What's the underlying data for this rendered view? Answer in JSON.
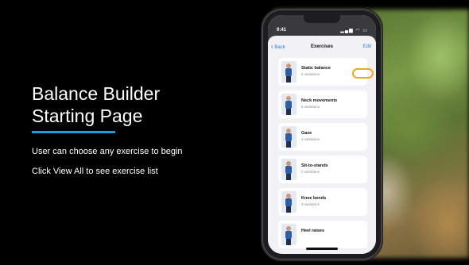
{
  "slide": {
    "title_line1": "Balance Builder",
    "title_line2": "Starting Page",
    "bullet1": "User can choose any exercise to begin",
    "bullet2": "Click View All to see exercise list",
    "accent_color": "#1c9bd8",
    "highlight_color": "#f5a623"
  },
  "phone": {
    "status_time": "9:41",
    "status_icons": "signal-icon wifi-icon battery-icon",
    "nav": {
      "back_label": "Back",
      "title": "Exercises",
      "edit_label": "Edit"
    },
    "exercises": [
      {
        "name": "Static balance",
        "sub": "4 variations"
      },
      {
        "name": "Neck movements",
        "sub": "6 variations"
      },
      {
        "name": "Gaze",
        "sub": "4 variations"
      },
      {
        "name": "Sit-to-stands",
        "sub": "2 variations"
      },
      {
        "name": "Knee bends",
        "sub": "3 variations"
      },
      {
        "name": "Heel raises",
        "sub": ""
      }
    ]
  }
}
